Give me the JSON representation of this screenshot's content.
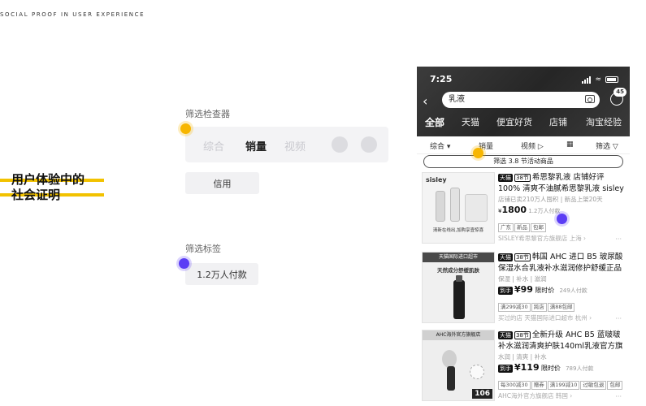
{
  "header": {
    "caption": "SOCIAL PROOF IN USER EXPERIENCE"
  },
  "title": {
    "line1": "用户体验中的",
    "line2": "社会证明"
  },
  "annotations": {
    "filter_section_label": "筛选检查器",
    "filter_tabs": [
      "综合",
      "销量",
      "视频"
    ],
    "credit_chip": "信用",
    "tag_section_label": "筛选标签",
    "payers_chip": "1.2万人付款"
  },
  "colors": {
    "accent_yellow": "#f7b600",
    "accent_purple": "#5b3df5",
    "stripe": "#f2c200"
  },
  "phone": {
    "status_time": "7:25",
    "search_value": "乳液",
    "message_badge": "45",
    "category_tabs": [
      "全部",
      "天猫",
      "便宜好货",
      "店铺",
      "淘宝经验"
    ],
    "sort_options": [
      "综合",
      "销量",
      "视频",
      "筛选"
    ],
    "promo_filter": "筛选 3.8 节活动商品",
    "products": [
      {
        "tags": [
          "天猫",
          "38节"
        ],
        "title": "希思黎乳液 店铺好评 100% 清爽不油腻希思黎乳液 sisley 限量全",
        "meta": "店铺已卖210万人囤积 | 新品上架20天",
        "price_prefix": "¥",
        "price": "1800",
        "sales": "1.2万人付款",
        "coupons": [
          "广东",
          "新品",
          "包邮"
        ],
        "store": "SISLEY希思黎官方旗舰店 上海",
        "image_brand": "sisley",
        "image_text": "清新在线出,加购享壹惊喜"
      },
      {
        "tags": [
          "天猫",
          "38节"
        ],
        "title": "韩国 AHC 进口 B5 玻尿酸保湿水合乳液补水滋润修护舒缓正品男",
        "meta": "保湿 | 补水 | 滋润",
        "price_label": "到手",
        "price": "¥99",
        "price_type": "限时价",
        "sales": "249人付款",
        "coupons": [
          "满299减30",
          "跨店",
          "满88包邮"
        ],
        "store": "买过的店 天猫国际进口超市 杭州",
        "image_banner": "天猫国际进口超市",
        "image_text": "天然成分舒缓肌肤"
      },
      {
        "tags": [
          "天猫",
          "38节"
        ],
        "title": "全新升级 AHC B5 蓝啵啵补水滋润清爽护肤140ml乳液官方旗舰",
        "meta": "水润 | 清爽 | 补水",
        "price_label": "到手",
        "price": "¥119",
        "price_type": "限时价",
        "sales": "789人付款",
        "coupons": [
          "每300减30",
          "赠券",
          "满199减10",
          "过敏包退",
          "包邮"
        ],
        "store": "AHC海外官方旗舰店 韩国",
        "image_banner": "AHC海外官方旗舰店",
        "image_price": "106"
      }
    ]
  }
}
